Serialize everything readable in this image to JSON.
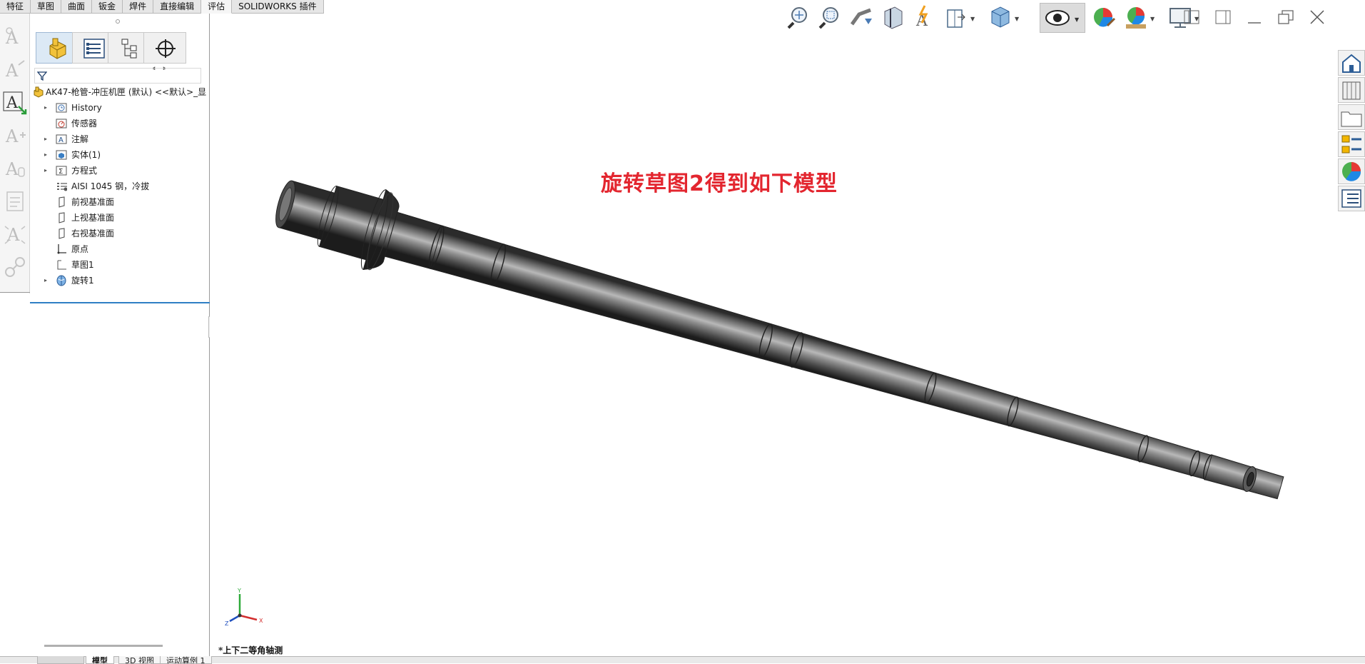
{
  "command_tabs": [
    "特征",
    "草图",
    "曲面",
    "钣金",
    "焊件",
    "直接编辑",
    "评估",
    "SOLIDWORKS 插件"
  ],
  "active_command_tab": "评估",
  "feature_tree": {
    "root": "AK47-枪管-冲压机匣 (默认) <<默认>_显",
    "items": [
      {
        "label": "History",
        "expandable": true,
        "icon": "history-icon"
      },
      {
        "label": "传感器",
        "expandable": false,
        "icon": "sensor-icon"
      },
      {
        "label": "注解",
        "expandable": true,
        "icon": "annotations-icon"
      },
      {
        "label": "实体(1)",
        "expandable": true,
        "icon": "solid-bodies-icon"
      },
      {
        "label": "方程式",
        "expandable": true,
        "icon": "equations-icon"
      },
      {
        "label": "AISI 1045 钢，冷拔",
        "expandable": false,
        "icon": "material-icon"
      },
      {
        "label": "前视基准面",
        "expandable": false,
        "icon": "plane-icon"
      },
      {
        "label": "上视基准面",
        "expandable": false,
        "icon": "plane-icon"
      },
      {
        "label": "右视基准面",
        "expandable": false,
        "icon": "plane-icon"
      },
      {
        "label": "原点",
        "expandable": false,
        "icon": "origin-icon"
      },
      {
        "label": "草图1",
        "expandable": false,
        "icon": "sketch-icon"
      },
      {
        "label": "旋转1",
        "expandable": true,
        "icon": "revolve-icon"
      }
    ]
  },
  "annotation_text": "旋转草图2得到如下模型",
  "view_name": "*上下二等角轴测",
  "triad": {
    "x": "X",
    "y": "Y",
    "z": "Z"
  },
  "bottom_tabs": [
    "",
    "模型",
    "3D 视图",
    "运动算例 1"
  ],
  "colors": {
    "annotation": "#e3262f",
    "selection_line": "#2f7fc4"
  }
}
